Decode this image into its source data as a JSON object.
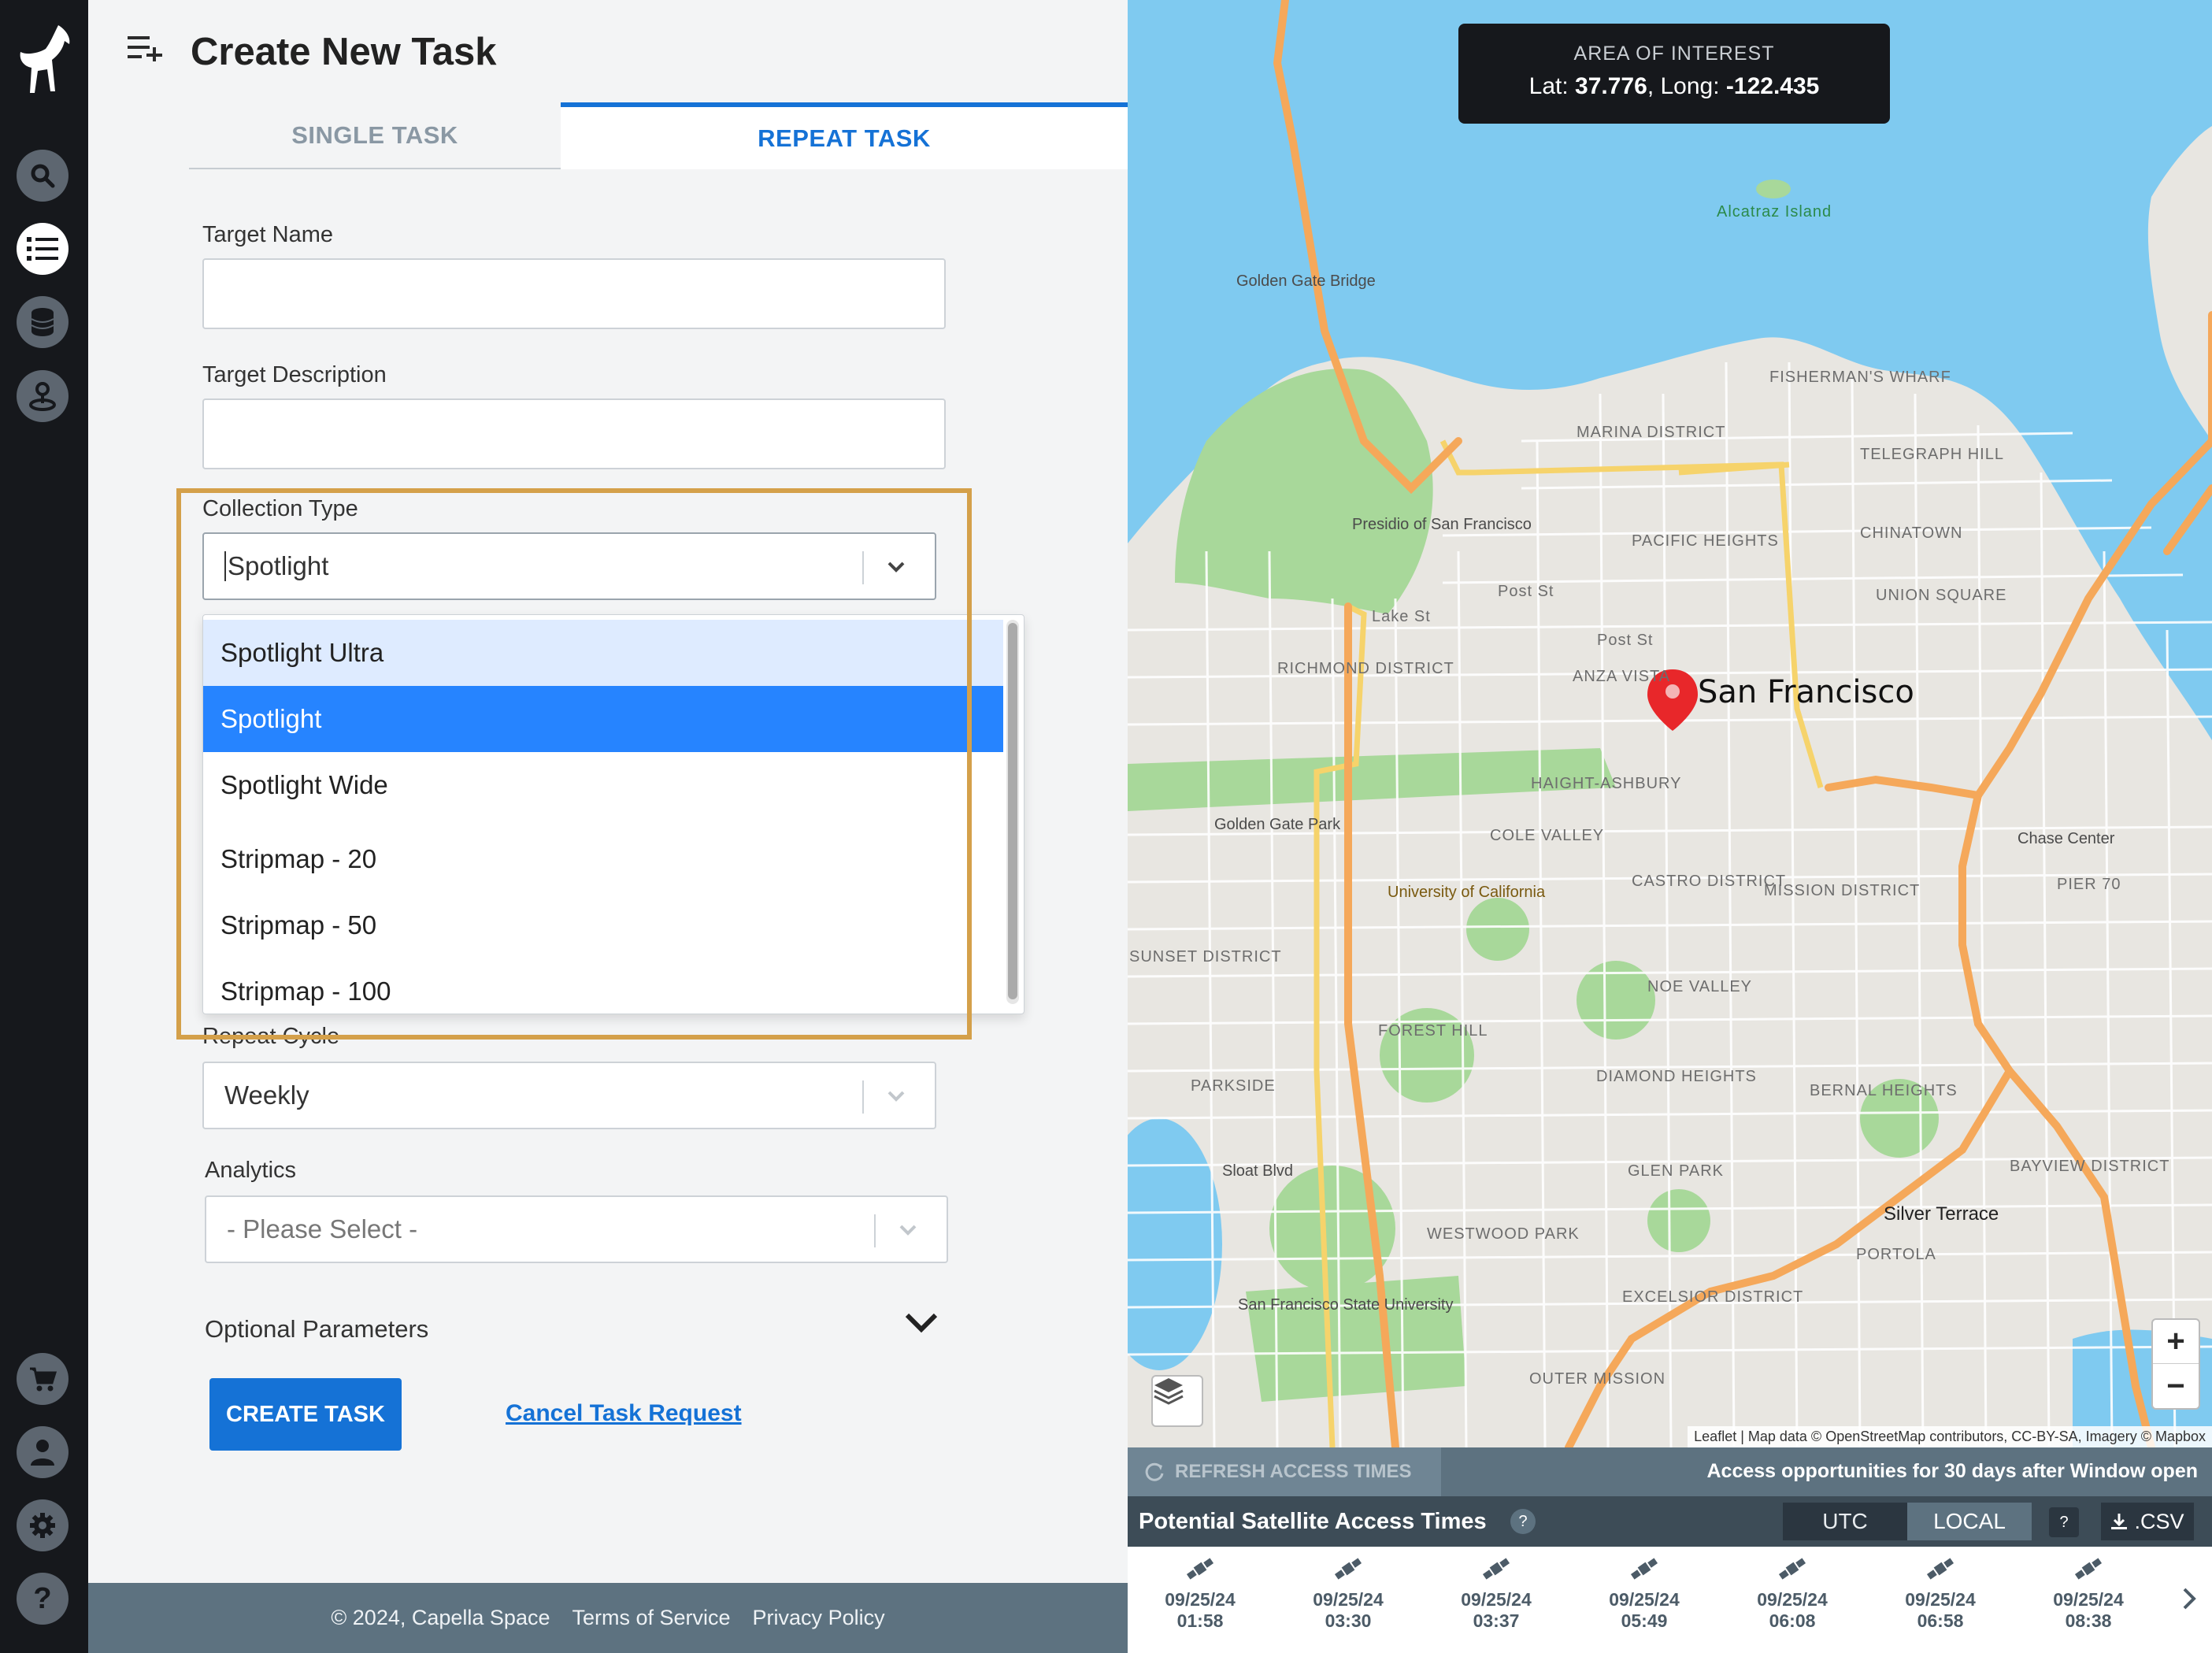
{
  "form": {
    "title": "Create New Task",
    "tabs": [
      {
        "label": "SINGLE TASK",
        "active": false
      },
      {
        "label": "REPEAT TASK",
        "active": true
      }
    ],
    "target_name": {
      "label": "Target Name",
      "value": ""
    },
    "target_description": {
      "label": "Target Description",
      "value": ""
    },
    "collection_type": {
      "label": "Collection Type",
      "value": "Spotlight",
      "options": [
        "Spotlight Ultra",
        "Spotlight",
        "Spotlight Wide",
        "Stripmap - 20",
        "Stripmap - 50",
        "Stripmap - 100"
      ],
      "hovered": "Spotlight Ultra",
      "selected": "Spotlight"
    },
    "repeat_cycle": {
      "label": "Repeat Cycle",
      "value": "Weekly"
    },
    "analytics": {
      "label": "Analytics",
      "value": "- Please Select -"
    },
    "optional_parameters": "Optional Parameters",
    "create_button": "CREATE TASK",
    "cancel_link": "Cancel Task Request"
  },
  "footer": {
    "copyright": "© 2024, Capella Space",
    "terms": "Terms of Service",
    "privacy": "Privacy Policy"
  },
  "map": {
    "aoi_title": "AREA OF INTEREST",
    "lat_label": "Lat:",
    "lat": "37.776",
    "long_label": "Long:",
    "long": "-122.435",
    "city_label": "San Francisco",
    "attribution": "Leaflet | Map data © OpenStreetMap contributors, CC-BY-SA, Imagery © Mapbox",
    "labels": {
      "golden_gate_bridge": "Golden Gate Bridge",
      "alcatraz": "Alcatraz Island",
      "fishermans_wharf": "FISHERMAN'S WHARF",
      "marina": "MARINA DISTRICT",
      "telegraph": "TELEGRAPH HILL",
      "presidio": "Presidio of San Francisco",
      "pacific_heights": "PACIFIC HEIGHTS",
      "chinatown": "CHINATOWN",
      "union_square": "UNION SQUARE",
      "richmond": "RICHMOND DISTRICT",
      "golden_gate_park": "Golden Gate Park",
      "haight": "HAIGHT-ASHBURY",
      "cole_valley": "COLE VALLEY",
      "ucsf": "University of California",
      "castro": "CASTRO DISTRICT",
      "mission": "MISSION DISTRICT",
      "sunset": "SUNSET DISTRICT",
      "noe_valley": "NOE VALLEY",
      "forest_hill": "FOREST HILL",
      "parkside": "PARKSIDE",
      "diamond_heights": "DIAMOND HEIGHTS",
      "bernal": "BERNAL HEIGHTS",
      "glen_park": "GLEN PARK",
      "westwood": "WESTWOOD PARK",
      "sfsu": "San Francisco State University",
      "excelsior": "EXCELSIOR DISTRICT",
      "outer_mission": "OUTER MISSION",
      "portola": "PORTOLA",
      "silver_terrace": "Silver Terrace",
      "bayview": "BAYVIEW DISTRICT",
      "chase_center": "Chase Center",
      "pier70": "PIER 70",
      "sloat": "Sloat Blvd",
      "lake_st": "Lake St",
      "post_st": "Post St",
      "anza": "ANZA VISTA"
    }
  },
  "access": {
    "refresh": "REFRESH ACCESS TIMES",
    "info": "Access opportunities for 30 days after Window open",
    "title": "Potential Satellite Access Times",
    "utc": "UTC",
    "local": "LOCAL",
    "csv": ".CSV",
    "times": [
      {
        "date": "09/25/24",
        "time": "01:58"
      },
      {
        "date": "09/25/24",
        "time": "03:30"
      },
      {
        "date": "09/25/24",
        "time": "03:37"
      },
      {
        "date": "09/25/24",
        "time": "05:49"
      },
      {
        "date": "09/25/24",
        "time": "06:08"
      },
      {
        "date": "09/25/24",
        "time": "06:58"
      },
      {
        "date": "09/25/24",
        "time": "08:38"
      }
    ]
  },
  "colors": {
    "accent": "#2684ff",
    "primary_button": "#1572d6",
    "rail": "#16181c",
    "water": "#7fcaf0",
    "park": "#a8d89a",
    "highway": "#f5a85a",
    "highlight_frame": "#d4a04a"
  }
}
